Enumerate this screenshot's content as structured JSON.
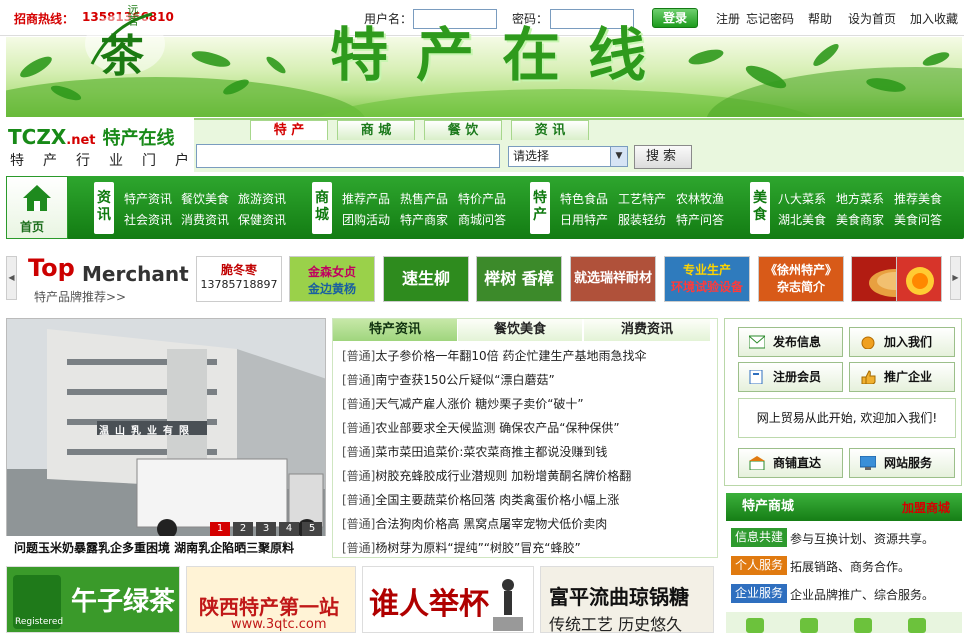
{
  "topbar": {
    "hotline_label": "招商热线：",
    "hotline_number": "13581366810",
    "username_label": "用户名：",
    "password_label": "密码：",
    "login_button": "登录",
    "links": [
      "注册",
      "忘记密码",
      "帮助",
      "设为首页",
      "加入收藏"
    ]
  },
  "banner": {
    "title": "特产在线",
    "logo_text": "茶",
    "logo_small": "远茗"
  },
  "site": {
    "logo_main": "TCZX",
    "logo_net": ".net",
    "logo_cn": "特产在线",
    "portal_label": "特产行业门户"
  },
  "search": {
    "tabs": [
      "特 产",
      "商 城",
      "餐 饮",
      "资 讯"
    ],
    "active_tab": 0,
    "input_value": "",
    "select_value": "请选择",
    "button": "搜索"
  },
  "nav": {
    "home_label": "首页",
    "groups": [
      {
        "tag": "资讯",
        "row1": [
          "特产资讯",
          "餐饮美食",
          "旅游资讯"
        ],
        "row2": [
          "社会资讯",
          "消费资讯",
          "保健资讯"
        ]
      },
      {
        "tag": "商城",
        "row1": [
          "推荐产品",
          "热售产品",
          "特价产品"
        ],
        "row2": [
          "团购活动",
          "特产商家",
          "商城问答"
        ]
      },
      {
        "tag": "特产",
        "row1": [
          "特色食品",
          "工艺特产",
          "农林牧渔"
        ],
        "row2": [
          "日用特产",
          "服装轻纺",
          "特产问答"
        ]
      },
      {
        "tag": "美食",
        "row1": [
          "八大菜系",
          "地方菜系",
          "推荐美食"
        ],
        "row2": [
          "湖北美食",
          "美食商家",
          "美食问答"
        ]
      }
    ]
  },
  "merchants": {
    "title_top": "Top",
    "title_rest": "Merchant",
    "subtitle": "特产品牌推荐>>",
    "ads": [
      {
        "text": "脆冬枣",
        "sub": "13785718897",
        "bg": "#ffffff",
        "fg": "#c00000"
      },
      {
        "text": "金森女贞",
        "sub": "金边黄杨",
        "bg": "#9ad14a",
        "fg": "#ffffff"
      },
      {
        "text": "速生柳",
        "sub": "",
        "bg": "#2e8b1e",
        "fg": "#ffffff"
      },
      {
        "text": "榉树 香樟",
        "sub": "",
        "bg": "#3c8a2a",
        "fg": "#ffffff"
      },
      {
        "text": "就选瑞祥耐材",
        "sub": "",
        "bg": "#b0513a",
        "fg": "#ffffff"
      },
      {
        "text": "专业生产",
        "sub": "环境试验设备",
        "bg": "#2f7bbd",
        "fg": "#ffd400"
      },
      {
        "text": "《徐州特产》",
        "sub": "杂志简介",
        "bg": "#d85a18",
        "fg": "#ffffff"
      },
      {
        "text": "",
        "sub": "",
        "bg": "#b21c12",
        "fg": "#ffffff"
      },
      {
        "text": "",
        "sub": "",
        "bg": "#d7342a",
        "fg": "#ffffff"
      }
    ]
  },
  "slideshow": {
    "caption": "问题玉米奶暴露乳企多重困境 湖南乳企陷晒三聚原料",
    "pages": [
      "1",
      "2",
      "3",
      "4",
      "5"
    ],
    "active_page": 0,
    "building_sign": "温山乳业有限"
  },
  "news": {
    "tabs": [
      "特产资讯",
      "餐饮美食",
      "消费资讯"
    ],
    "active_tab": 0,
    "items": [
      {
        "tag": "[普通]",
        "title": "太子参价格一年翻10倍  药企忙建生产基地雨急找伞"
      },
      {
        "tag": "[普通]",
        "title": "南宁查获150公斤疑似“漂白蘑菇”"
      },
      {
        "tag": "[普通]",
        "title": "天气减产雇人涨价  糖炒栗子卖价“破十”"
      },
      {
        "tag": "[普通]",
        "title": "农业部要求全天候监测  确保农产品“保种保供”"
      },
      {
        "tag": "[普通]",
        "title": "菜市菜田追菜价:菜农菜商推主都说没赚到钱"
      },
      {
        "tag": "[普通]",
        "title": "树胶充蜂胶成行业潜规则  加粉增黄酮名牌价格翻"
      },
      {
        "tag": "[普通]",
        "title": "全国主要蔬菜价格回落  肉类禽蛋价格小幅上涨"
      },
      {
        "tag": "[普通]",
        "title": "合法狗肉价格高  黑窝点屠宰宠物犬低价卖肉"
      },
      {
        "tag": "[普通]",
        "title": "杨树芽为原料“提纯”“树胶”冒充“蜂胶”"
      }
    ]
  },
  "member": {
    "publish": "发布信息",
    "join": "加入我们",
    "register": "注册会员",
    "promote": "推广企业",
    "welcome": "网上贸易从此开始, 欢迎加入我们!",
    "shop": "商铺直达",
    "site_service": "网站服务"
  },
  "mall": {
    "title": "特产商城",
    "join": "加盟商城",
    "services": [
      {
        "tag": "信息共建",
        "text": "参与互换计划、资源共享。",
        "color": "#2e9a2e"
      },
      {
        "tag": "个人服务",
        "text": "拓展销路、商务合作。",
        "color": "#e07a10"
      },
      {
        "tag": "企业服务",
        "text": "企业品牌推广、综合服务。",
        "color": "#2f6fbf"
      }
    ]
  },
  "bottom_ads": [
    {
      "text": "午子绿茶",
      "sub": "Registered",
      "bg": "#3a9a2a"
    },
    {
      "text": "陕西特产第一站",
      "sub": "www.3qtc.com",
      "bg": "#fff3d6"
    },
    {
      "text": "谁人举杯",
      "sub": "",
      "bg": "#ffffff"
    },
    {
      "text": "富平流曲琼锅糖",
      "sub": "传统工艺  历史悠久",
      "bg": "#f3f0e6"
    }
  ]
}
